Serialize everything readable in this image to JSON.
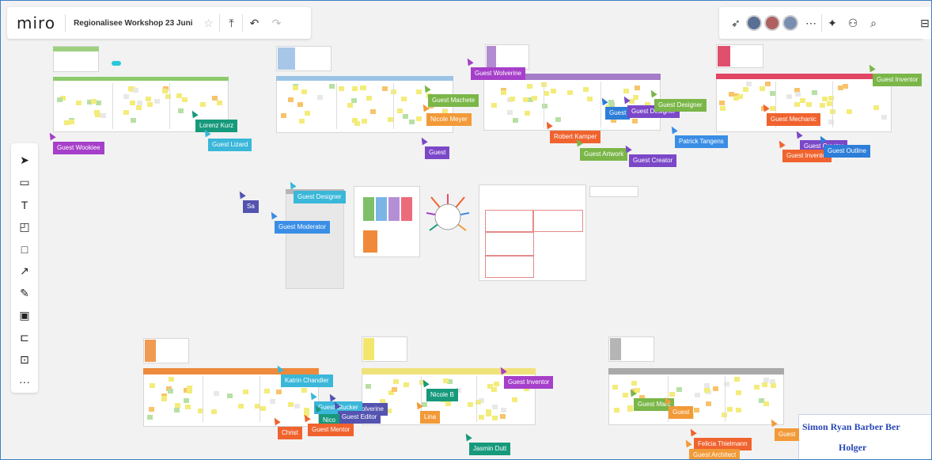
{
  "app": {
    "logo": "miro",
    "board_title": "Regionalisee Workshop 23 Juni"
  },
  "toolbar_left": {
    "star_icon": "star-icon",
    "share_icon": "upload-icon",
    "undo_icon": "undo-icon",
    "redo_icon": "redo-icon"
  },
  "toolbar_right": {
    "icons": [
      "cursor-icon",
      "avatar",
      "avatar",
      "avatar",
      "more-icon",
      "reactions-icon",
      "collab-icon",
      "search-icon",
      "panel-icon"
    ]
  },
  "tools": [
    {
      "name": "select-tool",
      "glyph": "➤"
    },
    {
      "name": "frame-tool",
      "glyph": "▭"
    },
    {
      "name": "text-tool",
      "glyph": "T"
    },
    {
      "name": "sticky-note-tool",
      "glyph": "◰"
    },
    {
      "name": "shape-tool",
      "glyph": "□"
    },
    {
      "name": "arrow-tool",
      "glyph": "↗"
    },
    {
      "name": "pen-tool",
      "glyph": "✎"
    },
    {
      "name": "comment-tool",
      "glyph": "▣"
    },
    {
      "name": "crop-tool",
      "glyph": "⊏"
    },
    {
      "name": "upload-tool",
      "glyph": "⊡"
    },
    {
      "name": "more-tools",
      "glyph": "···"
    }
  ],
  "cursors": [
    {
      "label": "Guest Wookiee",
      "color": "#a63fc9"
    },
    {
      "label": "Lorenz Kurz",
      "color": "#17997c"
    },
    {
      "label": "Guest Lizard",
      "color": "#3ab7d9"
    },
    {
      "label": "Guest Wolverine",
      "color": "#a63fc9"
    },
    {
      "label": "Guest Machete",
      "color": "#7ab648"
    },
    {
      "label": "Nicole Meyer",
      "color": "#f29a38"
    },
    {
      "label": "Guest",
      "color": "#7b48c8"
    },
    {
      "label": "Guest",
      "color": "#2d7ed8"
    },
    {
      "label": "Guest Designer",
      "color": "#7b48c8"
    },
    {
      "label": "Guest Designer",
      "color": "#7ab648"
    },
    {
      "label": "Guest Inventor",
      "color": "#7ab648"
    },
    {
      "label": "Guest Mechanic",
      "color": "#f0632e"
    },
    {
      "label": "Robert Kamper",
      "color": "#f0632e"
    },
    {
      "label": "Guest Artwork",
      "color": "#7ab648"
    },
    {
      "label": "Guest Creator",
      "color": "#7b48c8"
    },
    {
      "label": "Patrick Tangens",
      "color": "#3a8ee6"
    },
    {
      "label": "Guest Creator",
      "color": "#7b48c8"
    },
    {
      "label": "Guest Inventor",
      "color": "#f0632e"
    },
    {
      "label": "Guest Outline",
      "color": "#2d7ed8"
    },
    {
      "label": "Guest Designer",
      "color": "#3ab7d9"
    },
    {
      "label": "Guest Moderator",
      "color": "#3a8ee6"
    },
    {
      "label": "Sa",
      "color": "#5353b0"
    },
    {
      "label": "Katrin Chandler",
      "color": "#3ab7d9"
    },
    {
      "label": "Guest Inventor",
      "color": "#a63fc9"
    },
    {
      "label": "Nicole B",
      "color": "#17997c"
    },
    {
      "label": "Guest Wolverine",
      "color": "#5353b0"
    },
    {
      "label": "Guest Stucker",
      "color": "#3ab7d9"
    },
    {
      "label": "Guest Editor",
      "color": "#5353b0"
    },
    {
      "label": "Nico",
      "color": "#17997c"
    },
    {
      "label": "Lina",
      "color": "#f29a38"
    },
    {
      "label": "Guest Mentor",
      "color": "#f0632e"
    },
    {
      "label": "Christ",
      "color": "#f0632e"
    },
    {
      "label": "Jasmin Dutt",
      "color": "#17997c"
    },
    {
      "label": "Guest Marc",
      "color": "#7ab648"
    },
    {
      "label": "Guest",
      "color": "#f29a38"
    },
    {
      "label": "Felicia Thielmann",
      "color": "#f0632e"
    },
    {
      "label": "Guest Architect",
      "color": "#f29a38"
    },
    {
      "label": "Guest",
      "color": "#f29a38"
    }
  ],
  "blue_card": {
    "line1": "Simon Ryan Barber Ber",
    "line2": "Holger"
  }
}
